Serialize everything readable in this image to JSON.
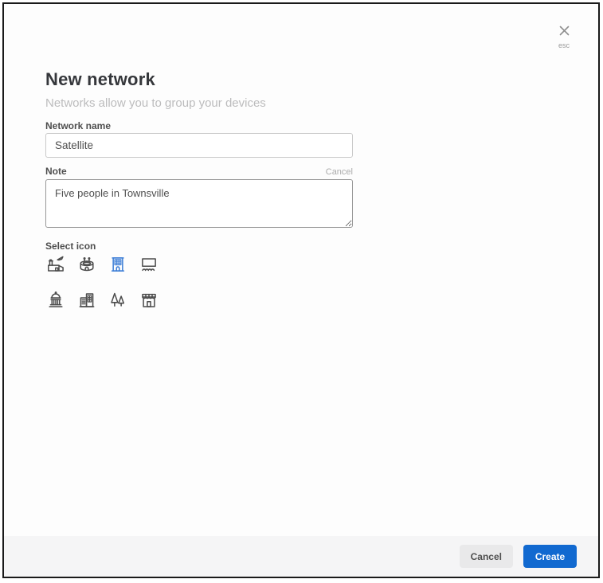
{
  "modal": {
    "title": "New network",
    "subtitle": "Networks allow you to group your devices",
    "close": {
      "icon": "x-icon",
      "hint": "esc"
    },
    "fields": {
      "network_name": {
        "label": "Network name",
        "value": "Satellite"
      },
      "note": {
        "label": "Note",
        "cancel_label": "Cancel",
        "value": "Five people in Townsville"
      }
    },
    "icon_picker": {
      "label": "Select icon",
      "selected": "building",
      "options": [
        {
          "name": "airport-icon"
        },
        {
          "name": "stadium-icon"
        },
        {
          "name": "building-icon",
          "selected": true
        },
        {
          "name": "screen-crowd-icon"
        },
        {
          "name": "capitol-icon"
        },
        {
          "name": "office-buildings-icon"
        },
        {
          "name": "park-trees-icon"
        },
        {
          "name": "store-icon"
        }
      ]
    },
    "footer": {
      "cancel_label": "Cancel",
      "create_label": "Create"
    },
    "colors": {
      "accent": "#1169d0",
      "selected_icon": "#3e7fd7"
    }
  }
}
